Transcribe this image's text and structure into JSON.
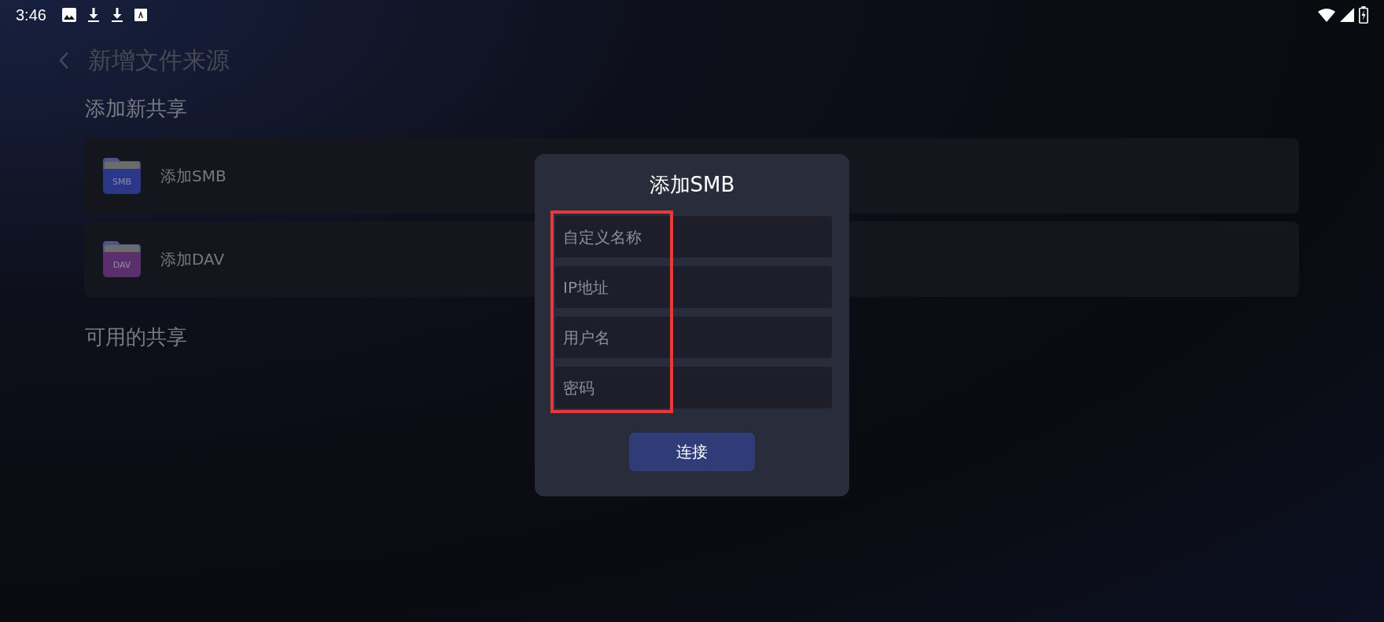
{
  "status_bar": {
    "time": "3:46"
  },
  "header": {
    "title": "新增文件来源"
  },
  "add_section": {
    "title": "添加新共享",
    "items": [
      {
        "label": "添加SMB",
        "badge": "SMB",
        "color": "#2b3788"
      },
      {
        "label": "添加DAV",
        "badge": "DAV",
        "color": "#5b2f6c"
      }
    ]
  },
  "available_section": {
    "title": "可用的共享"
  },
  "dialog": {
    "title": "添加SMB",
    "fields": [
      {
        "placeholder": "自定义名称"
      },
      {
        "placeholder": "IP地址"
      },
      {
        "placeholder": "用户名"
      },
      {
        "placeholder": "密码"
      }
    ],
    "button": "连接"
  }
}
